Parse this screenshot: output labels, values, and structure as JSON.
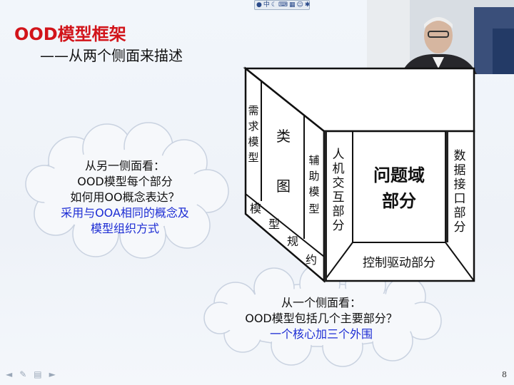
{
  "toolbar": {
    "icons": [
      "globe-icon",
      "zh-icon",
      "moon-icon",
      "keyboard-icon",
      "grid-icon",
      "person-icon",
      "settings-icon"
    ],
    "zh_glyph": "中"
  },
  "slide": {
    "title": "OOD模型框架",
    "subtitle": "——从两个侧面来描述",
    "box": {
      "front_center": [
        "问题域",
        "部分"
      ],
      "front_left": [
        "人",
        "机",
        "交",
        "互",
        "部",
        "分"
      ],
      "front_right": [
        "数",
        "据",
        "接",
        "口",
        "部",
        "分"
      ],
      "front_bottom": "控制驱动部分",
      "side_col1": [
        "需",
        "求",
        "模",
        "型"
      ],
      "side_col2": [
        "类",
        "图"
      ],
      "side_col3": [
        "辅",
        "助",
        "模",
        "型"
      ],
      "side_diag": [
        "模",
        "型",
        "规",
        "约"
      ]
    },
    "cloud_left": {
      "lines": [
        "从另一侧面看：",
        "OOD模型每个部分",
        "如何用OO概念表达？"
      ],
      "blue_lines": [
        "采用与OOA相同的概念及",
        "模型组织方式"
      ]
    },
    "cloud_bottom": {
      "lines": [
        "从一个侧面看：",
        "OOD模型包括几个主要部分？"
      ],
      "blue_lines": [
        "一个核心加三个外围"
      ]
    },
    "page_number": "8"
  },
  "colors": {
    "title": "#d2141a",
    "blue_text": "#1d2dd4",
    "box_stroke": "#111111"
  }
}
